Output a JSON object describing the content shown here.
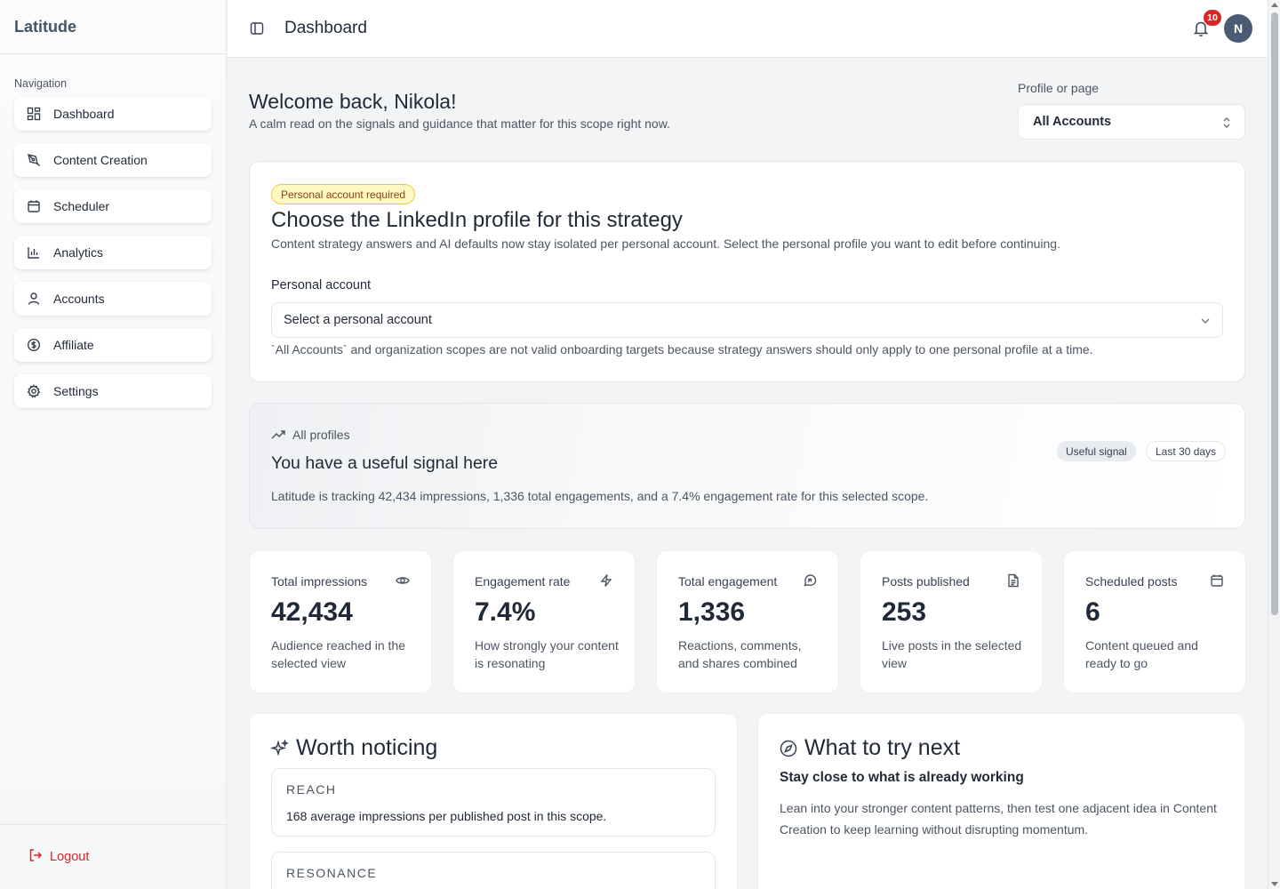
{
  "app": {
    "brand": "Latitude"
  },
  "sidebar": {
    "section_label": "Navigation",
    "items": [
      {
        "label": "Dashboard",
        "icon": "dashboard-icon"
      },
      {
        "label": "Content Creation",
        "icon": "pen-icon"
      },
      {
        "label": "Scheduler",
        "icon": "calendar-icon"
      },
      {
        "label": "Analytics",
        "icon": "bar-chart-icon"
      },
      {
        "label": "Accounts",
        "icon": "user-icon"
      },
      {
        "label": "Affiliate",
        "icon": "dollar-circle-icon"
      },
      {
        "label": "Settings",
        "icon": "gear-icon"
      }
    ],
    "logout_label": "Logout"
  },
  "header": {
    "title": "Dashboard",
    "notification_count": "10",
    "avatar_initial": "N"
  },
  "welcome": {
    "title": "Welcome back, Nikola!",
    "subtitle": "A calm read on the signals and guidance that matter for this scope right now."
  },
  "profile_select": {
    "label": "Profile or page",
    "value": "All Accounts"
  },
  "strategy_card": {
    "badge": "Personal account required",
    "title": "Choose the LinkedIn profile for this strategy",
    "description": "Content strategy answers and AI defaults now stay isolated per personal account. Select the personal profile you want to edit before continuing.",
    "field_label": "Personal account",
    "select_placeholder": "Select a personal account",
    "note": "`All Accounts` and organization scopes are not valid onboarding targets because strategy answers should only apply to one personal profile at a time."
  },
  "signal_card": {
    "kicker": "All profiles",
    "title": "You have a useful signal here",
    "description": "Latitude is tracking 42,434 impressions, 1,336 total engagements, and a 7.4% engagement rate for this selected scope.",
    "chips": [
      "Useful signal",
      "Last 30 days"
    ]
  },
  "stats": [
    {
      "label": "Total impressions",
      "value": "42,434",
      "desc": "Audience reached in the selected view",
      "icon": "eye-icon"
    },
    {
      "label": "Engagement rate",
      "value": "7.4%",
      "desc": "How strongly your content is resonating",
      "icon": "bolt-icon"
    },
    {
      "label": "Total engagement",
      "value": "1,336",
      "desc": "Reactions, comments, and shares combined",
      "icon": "message-circle-icon"
    },
    {
      "label": "Posts published",
      "value": "253",
      "desc": "Live posts in the selected view",
      "icon": "document-icon"
    },
    {
      "label": "Scheduled posts",
      "value": "6",
      "desc": "Content queued and ready to go",
      "icon": "calendar-icon"
    }
  ],
  "worth_noticing": {
    "title": "Worth noticing",
    "items": [
      {
        "label": "REACH",
        "text": "168 average impressions per published post in this scope."
      },
      {
        "label": "RESONANCE",
        "text": ""
      }
    ]
  },
  "try_next": {
    "title": "What to try next",
    "subtitle": "Stay close to what is already working",
    "text": "Lean into your stronger content patterns, then test one adjacent idea in Content Creation to keep learning without disrupting momentum."
  },
  "colors": {
    "accent": "#44546a",
    "danger": "#dc2626",
    "warn_bg": "#fef9c3",
    "warn_border": "#f5c542"
  }
}
